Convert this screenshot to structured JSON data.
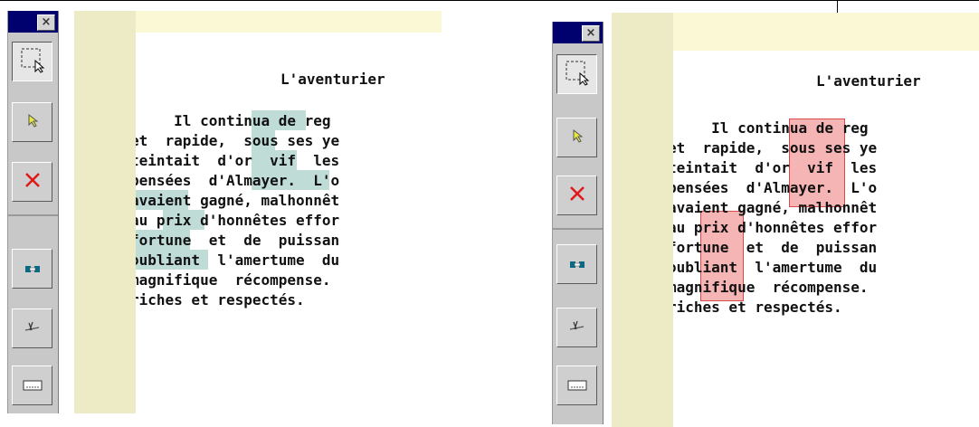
{
  "toolbar": {
    "close_label": "×",
    "tools": [
      {
        "name": "select-region-icon"
      },
      {
        "name": "pointer-icon"
      },
      {
        "name": "delete-icon"
      },
      {
        "name": "link-icon"
      },
      {
        "name": "cut-icon"
      },
      {
        "name": "text-field-icon"
      }
    ]
  },
  "document": {
    "title": "L'aventurier",
    "lines": [
      "     Il continua de reg",
      "et  rapide,  sous ses ye",
      "teintait  d'or  vif  les",
      "pensées  d'Almayer.  L'o",
      "avaient gagné, malhonnêt",
      "au prix d'honnêtes effor",
      "fortune  et  de  puissan",
      "oubliant  l'amertume  du",
      "magnifique  récompense.",
      "riches et respectés."
    ]
  },
  "colors": {
    "canvas": "#fbf8d5",
    "highlight_teal": "#bfdcd7",
    "highlight_red": "#ee7878",
    "toolbar_title": "#00006e"
  }
}
